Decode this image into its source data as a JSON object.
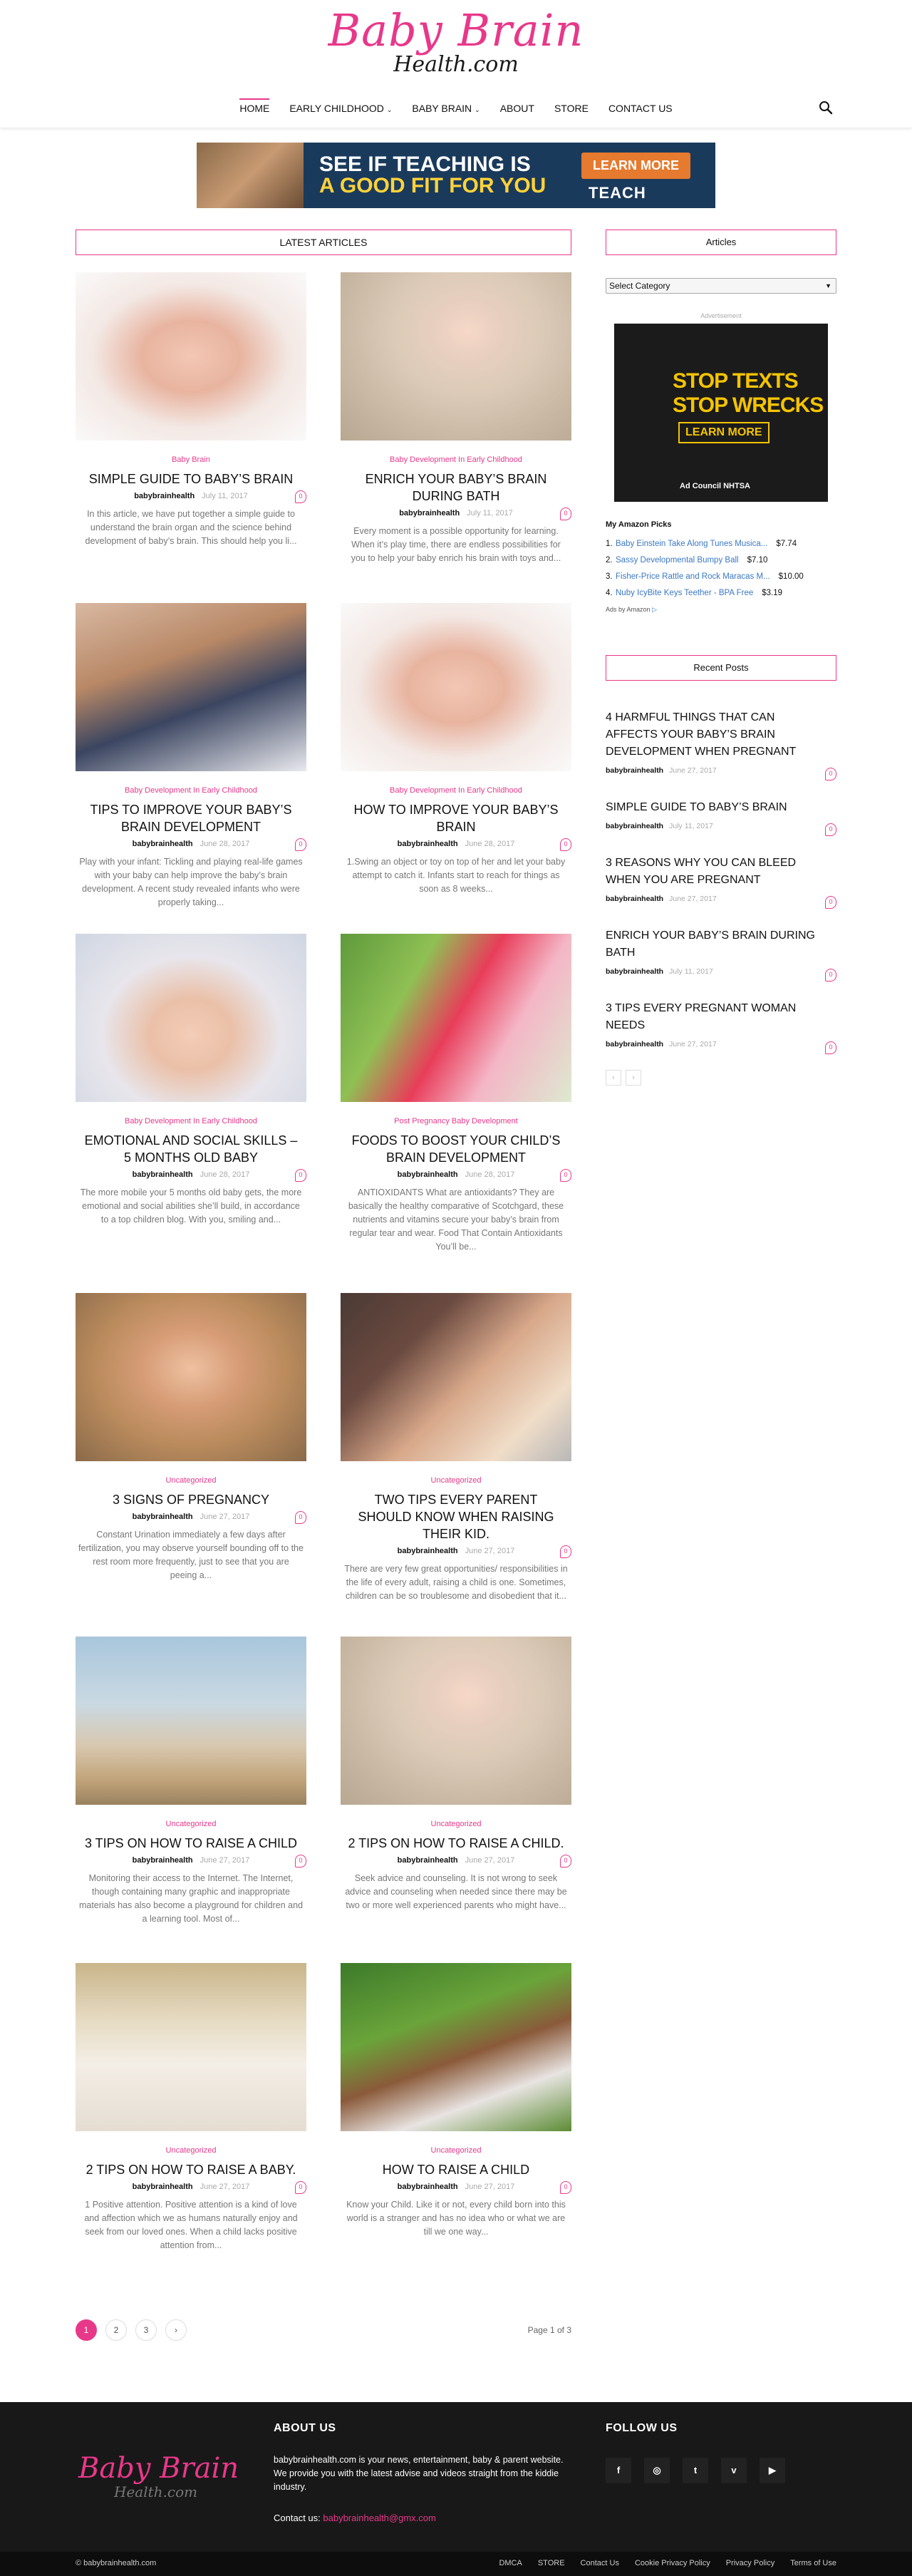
{
  "logo": {
    "line1": "Baby Brain",
    "line2": "Health.com"
  },
  "nav": {
    "items": [
      {
        "label": "HOME",
        "active": true
      },
      {
        "label": "EARLY CHILDHOOD",
        "caret": "⌄"
      },
      {
        "label": "BABY BRAIN",
        "caret": "⌄"
      },
      {
        "label": "ABOUT"
      },
      {
        "label": "STORE"
      },
      {
        "label": "CONTACT US"
      }
    ]
  },
  "banner_ad": {
    "headline_a": "SEE IF TEACHING IS",
    "headline_b": "A GOOD FIT FOR YOU",
    "cta": "LEARN MORE",
    "brand": "TEACH"
  },
  "main": {
    "block_title": "LATEST ARTICLES",
    "articles": [
      {
        "category": "Baby Brain",
        "title": "SIMPLE GUIDE TO BABY’S BRAIN",
        "author": "babybrainhealth",
        "date": "July 11, 2017",
        "comments": "0",
        "excerpt": "In this article, we have put together a simple guide to understand the brain organ and the science behind development of baby’s brain. This should help you li...",
        "image": "img-baby-face"
      },
      {
        "category": "Baby Development In Early Childhood",
        "title": "ENRICH YOUR BABY’S BRAIN DURING BATH",
        "author": "babybrainhealth",
        "date": "July 11, 2017",
        "comments": "0",
        "excerpt": "Every moment is a possible opportunity for learning. When it’s play time, there are endless possibilities for you to help your baby enrich his brain with toys and...",
        "image": "img-baby-blanket"
      },
      {
        "category": "Baby Development In Early Childhood",
        "title": "TIPS TO IMPROVE YOUR BABY’S BRAIN DEVELOPMENT",
        "author": "babybrainhealth",
        "date": "June 28, 2017",
        "comments": "0",
        "excerpt": "Play with your infant: Tickling and playing real-life games with your baby can help improve the baby’s brain development. A recent study revealed infants who were properly taking...",
        "image": "img-mother-kiss"
      },
      {
        "category": "Baby Development In Early Childhood",
        "title": "HOW TO IMPROVE YOUR BABY’S BRAIN",
        "author": "babybrainhealth",
        "date": "June 28, 2017",
        "comments": "0",
        "excerpt": "1.Swing an object or toy on top of her and let your baby attempt to catch it. Infants start to reach for things as soon as 8 weeks...",
        "image": "img-baby-face"
      },
      {
        "category": "Baby Development In Early Childhood",
        "title": "EMOTIONAL AND SOCIAL SKILLS – 5 MONTHS OLD BABY",
        "author": "babybrainhealth",
        "date": "June 28, 2017",
        "comments": "0",
        "excerpt": "The more mobile your 5 months old baby gets, the more emotional and social abilities she’ll build, in accordance to a top children blog. With you, smiling and...",
        "image": "img-baby-towel"
      },
      {
        "category": "Post Pregnancy Baby Development",
        "title": "FOODS TO BOOST YOUR CHILD’S BRAIN DEVELOPMENT",
        "author": "babybrainhealth",
        "date": "June 28, 2017",
        "comments": "0",
        "excerpt": "ANTIOXIDANTS What are antioxidants? They are basically the healthy comparative of Scotchgard, these nutrients and vitamins secure your baby’s brain from regular tear and wear. Food That Contain Antioxidants You’ll be...",
        "image": "img-watermelon"
      },
      {
        "category": "Uncategorized",
        "title": "3 SIGNS OF PREGNANCY",
        "author": "babybrainhealth",
        "date": "June 27, 2017",
        "comments": "0",
        "excerpt": "Constant Urination immediately a few days after fertilization, you may observe yourself bounding off to the rest room more frequently, just to see that you are peeing a...",
        "image": "img-woman-smile"
      },
      {
        "category": "Uncategorized",
        "title": "TWO TIPS EVERY PARENT SHOULD KNOW WHEN RAISING THEIR KID.",
        "author": "babybrainhealth",
        "date": "June 27, 2017",
        "comments": "0",
        "excerpt": "There are very few great opportunities/ responsibilities in the life of every adult, raising a child is one. Sometimes, children can be so troublesome and disobedient that it...",
        "image": "img-father-child"
      },
      {
        "category": "Uncategorized",
        "title": "3 TIPS ON HOW TO RAISE A CHILD",
        "author": "babybrainhealth",
        "date": "June 27, 2017",
        "comments": "0",
        "excerpt": "Monitoring their access to the Internet. The Internet, though containing many graphic and inappropriate materials has also become a playground for children and a learning tool. Most of...",
        "image": "img-beach-walk"
      },
      {
        "category": "Uncategorized",
        "title": "2 TIPS ON HOW TO RAISE A CHILD.",
        "author": "babybrainhealth",
        "date": "June 27, 2017",
        "comments": "0",
        "excerpt": "Seek advice and counseling. It is not wrong to seek advice and counseling when needed since there may be two or more well experienced parents who might have...",
        "image": "img-baby-blanket"
      },
      {
        "category": "Uncategorized",
        "title": "2 TIPS ON HOW TO RAISE A BABY.",
        "author": "babybrainhealth",
        "date": "June 27, 2017",
        "comments": "0",
        "excerpt": "1 Positive attention. Positive attention is a kind of love and affection which we as humans naturally enjoy and seek from our loved ones. When a child lacks positive attention from...",
        "image": "img-baby-shoes"
      },
      {
        "category": "Uncategorized",
        "title": "HOW TO RAISE A CHILD",
        "author": "babybrainhealth",
        "date": "June 27, 2017",
        "comments": "0",
        "excerpt": "Know your Child. Like it or not, every child born into this world is a stranger and has no idea who or what we are till we one way...",
        "image": "img-mother-park"
      }
    ]
  },
  "pagination": {
    "pages": [
      "1",
      "2",
      "3"
    ],
    "next": "›",
    "label": "Page 1 of 3"
  },
  "sidebar": {
    "articles_title": "Articles",
    "select_value": "Select Category",
    "ad_label": "Advertisement",
    "side_ad": {
      "line1": "STOP TEXTS",
      "line2": "STOP WRECKS",
      "cta": "LEARN MORE",
      "logos": "Ad Council  NHTSA"
    },
    "amazon_title": "My Amazon Picks",
    "amazon_items": [
      {
        "num": "1.",
        "name": "Baby Einstein Take Along Tunes Musica...",
        "price": "$7.74"
      },
      {
        "num": "2.",
        "name": "Sassy Developmental Bumpy Ball",
        "price": "$7.10"
      },
      {
        "num": "3.",
        "name": "Fisher-Price Rattle and Rock Maracas M...",
        "price": "$10.00"
      },
      {
        "num": "4.",
        "name": "Nuby IcyBite Keys Teether - BPA Free",
        "price": "$3.19"
      }
    ],
    "ads_by": "Ads by Amazon",
    "recent_title": "Recent Posts",
    "recent_posts": [
      {
        "title": "4 HARMFUL THINGS THAT CAN AFFECTS YOUR BABY’S BRAIN DEVELOPMENT WHEN PREGNANT",
        "author": "babybrainhealth",
        "date": "June 27, 2017",
        "comments": "0"
      },
      {
        "title": "SIMPLE GUIDE TO BABY’S BRAIN",
        "author": "babybrainhealth",
        "date": "July 11, 2017",
        "comments": "0"
      },
      {
        "title": "3 REASONS WHY YOU CAN BLEED WHEN YOU ARE PREGNANT",
        "author": "babybrainhealth",
        "date": "June 27, 2017",
        "comments": "0"
      },
      {
        "title": "ENRICH YOUR BABY’S BRAIN DURING BATH",
        "author": "babybrainhealth",
        "date": "July 11, 2017",
        "comments": "0"
      },
      {
        "title": "3 TIPS EVERY PREGNANT WOMAN NEEDS",
        "author": "babybrainhealth",
        "date": "June 27, 2017",
        "comments": "0"
      }
    ],
    "recent_prev": "‹",
    "recent_next": "›"
  },
  "footer": {
    "logo_line1": "Baby Brain",
    "logo_line2": "Health.com",
    "about_heading": "ABOUT US",
    "about_text": "babybrainhealth.com is your news, entertainment, baby & parent website. We provide you with the latest advise and videos straight from the kiddie industry.",
    "contact_label": "Contact us:",
    "contact_email": "babybrainhealth@gmx.com",
    "follow_heading": "FOLLOW US",
    "socials": [
      "f",
      "◎",
      "t",
      "v",
      "▶"
    ],
    "copyright": "© babybrainhealth.com",
    "links": [
      "DMCA",
      "STORE",
      "Contact Us",
      "Cookie Privacy Policy",
      "Privacy Policy",
      "Terms of Use"
    ]
  },
  "colors": {
    "accent": "#e8388a",
    "footer_bg": "#181818"
  }
}
